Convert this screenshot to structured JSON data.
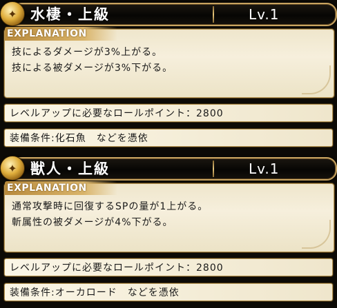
{
  "skills": [
    {
      "title": "水棲・上級",
      "level": "Lv.1",
      "section_label": "EXPLANATION",
      "description": [
        "技によるダメージが3%上がる。",
        "技による被ダメージが3%下がる。"
      ],
      "cost_text": "レベルアップに必要なロールポイント：2800",
      "equip_text": "装備条件:化石魚　などを憑依"
    },
    {
      "title": "獣人・上級",
      "level": "Lv.1",
      "section_label": "EXPLANATION",
      "description": [
        "通常攻撃時に回復するSPの量が1上がる。",
        "斬属性の被ダメージが4%下がる。"
      ],
      "cost_text": "レベルアップに必要なロールポイント：2800",
      "equip_text": "装備条件:オーカロード　などを憑依"
    }
  ],
  "icons": {
    "emblem": "gold-emblem-icon"
  },
  "colors": {
    "frame_gold": "#c9a460",
    "panel_bg": "#f6efdc",
    "tab_gold": "#d9b46a"
  }
}
